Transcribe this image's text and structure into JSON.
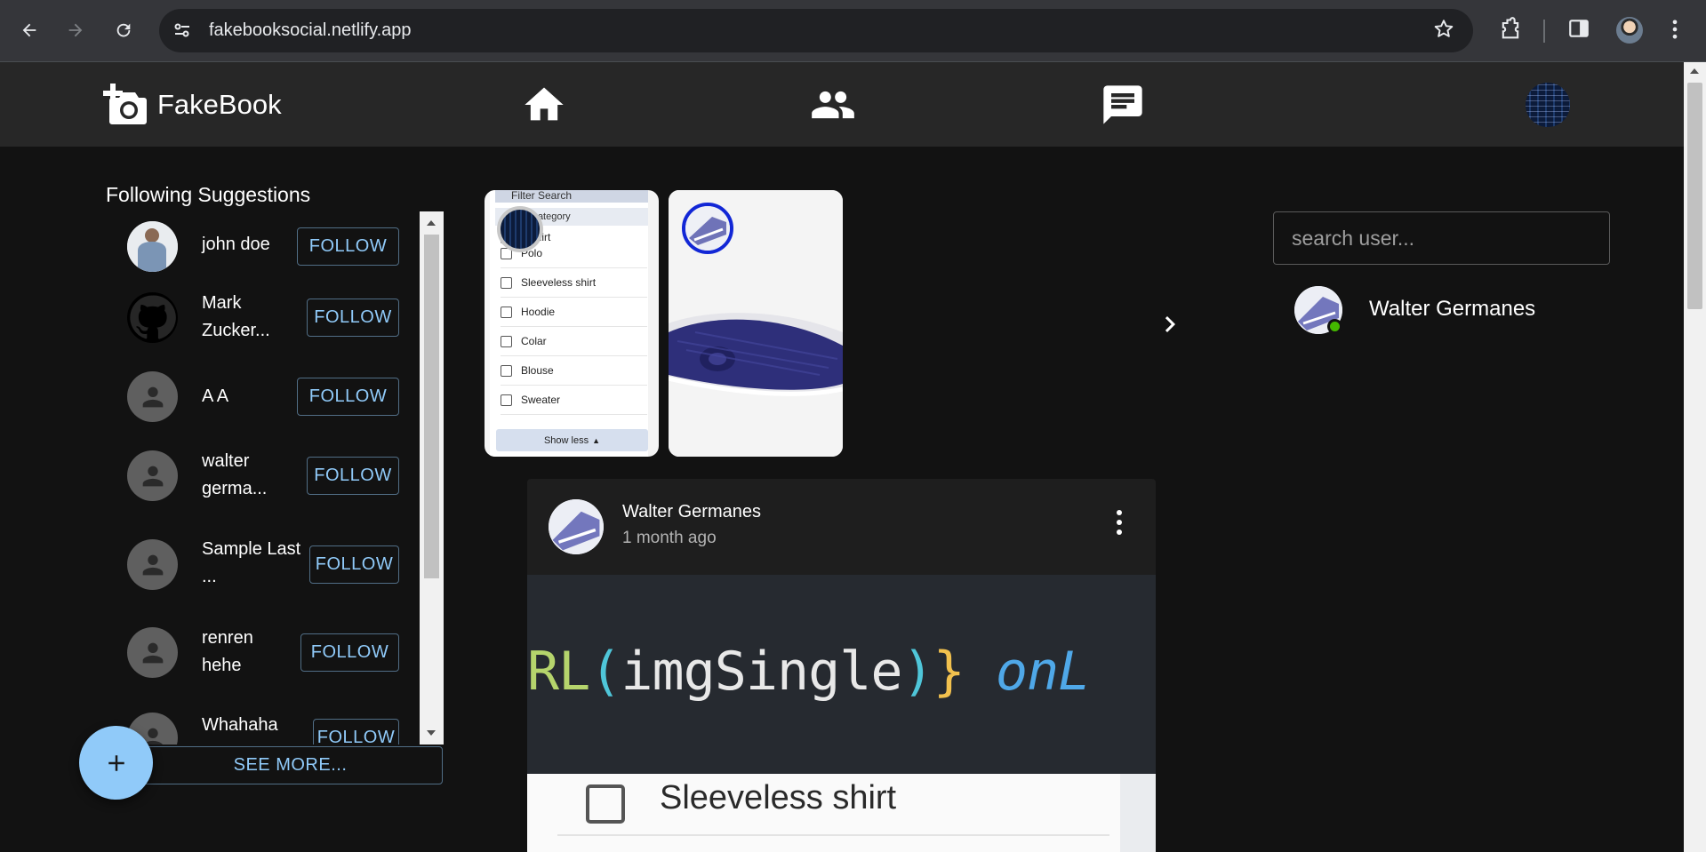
{
  "browser": {
    "url": "fakebooksocial.netlify.app",
    "icons": [
      "back-arrow-icon",
      "forward-arrow-icon",
      "reload-icon",
      "site-settings-icon",
      "bookmark-star-icon",
      "extensions-icon",
      "side-panel-icon",
      "profile-avatar",
      "kebab-menu-icon"
    ]
  },
  "header": {
    "app_name": "FakeBook",
    "nav": [
      {
        "name": "home",
        "icon": "home-icon"
      },
      {
        "name": "friends",
        "icon": "people-icon"
      },
      {
        "name": "messages",
        "icon": "chat-icon"
      }
    ]
  },
  "suggestions": {
    "title": "Following Suggestions",
    "follow_label": "FOLLOW",
    "see_more_label": "SEE MORE...",
    "items": [
      {
        "name": "john doe",
        "avatar": "photo"
      },
      {
        "name": "Mark Zucker...",
        "avatar": "github-logo"
      },
      {
        "name": "A A",
        "avatar": "default-person"
      },
      {
        "name": "walter germa...",
        "avatar": "default-person"
      },
      {
        "name": "Sample Last ...",
        "avatar": "default-person"
      },
      {
        "name": "renren hehe",
        "avatar": "default-person"
      },
      {
        "name": "Whahaha",
        "avatar": "default-person"
      }
    ]
  },
  "fab": {
    "label": "+"
  },
  "stories": {
    "story1": {
      "filter_header": "Filter Search",
      "category": "Category",
      "first_option": "T-shirt",
      "options": [
        "Polo",
        "Sleeveless shirt",
        "Hoodie",
        "Colar",
        "Blouse",
        "Sweater"
      ],
      "show_less": "Show less"
    }
  },
  "search": {
    "placeholder": "search user..."
  },
  "online_users": [
    {
      "name": "Walter Germanes",
      "status": "online"
    }
  ],
  "post": {
    "author": "Walter Germanes",
    "time": "1 month ago",
    "code_parts": [
      "RL",
      "(",
      "imgSingle",
      ")",
      "}",
      " ",
      "onL"
    ],
    "image_lower_label": "Sleeveless shirt"
  },
  "colors": {
    "background": "#121212",
    "appbar": "#272727",
    "accent": "#90caf9",
    "online": "#44b700",
    "story_ring": "#1227d6"
  }
}
